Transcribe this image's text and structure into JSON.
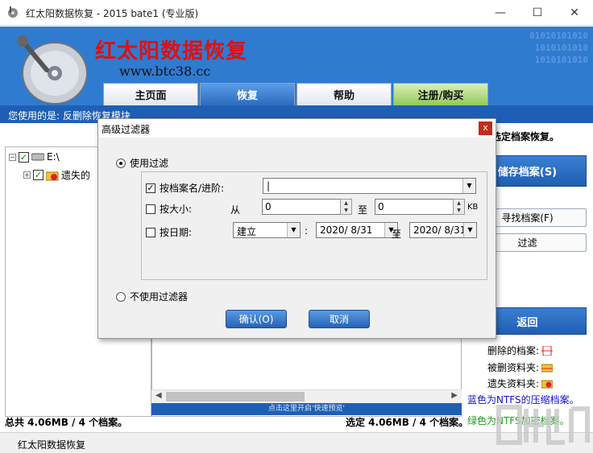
{
  "window": {
    "title": "红太阳数据恢复 - 2015 bate1 (专业版)",
    "minimize": "—",
    "maximize": "☐",
    "close": "✕"
  },
  "banner": {
    "brand": "红太阳数据恢复",
    "url": "www.btc38.cc",
    "binary_lines": [
      "01010101010",
      "1010101010",
      "1010101010"
    ]
  },
  "nav_tabs": [
    {
      "label": "主页面"
    },
    {
      "label": "恢复"
    },
    {
      "label": "帮助"
    },
    {
      "label": "注册/购买"
    }
  ],
  "status_top": "您使用的是: 反删除恢复模块",
  "main": {
    "right_hint": "选定档案恢复。",
    "tree": {
      "drive_label": "E:\\",
      "child_label": "遗失的\u0000"
    },
    "buttons": {
      "save": "储存档案(S)",
      "find": "寻找档案(F)",
      "filter": "过滤",
      "back": "返回"
    },
    "legend": {
      "deleted": "删除的档案:",
      "deleted_folder": "被删资料夹:",
      "lost_folder": "遗失资料夹:",
      "blue_note": "蓝色为NTFS的压缩档案。",
      "green_note": "绿色为NTFS加密档案。"
    },
    "preview_bar": "点击这里开启'快速预览'",
    "total_stats": "总共 4.06MB / 4 个档案。",
    "selected_stats": "选定 4.06MB / 4 个档案。"
  },
  "statusbar": "红太阳数据恢复",
  "dialog": {
    "title": "高级过滤器",
    "close": "x",
    "use_filter": "使用过滤",
    "name_path": "按档案名/进阶:",
    "name_value": "|",
    "by_size": "按大小:",
    "from": "从",
    "size_from": "0",
    "to": "至",
    "size_to": "0",
    "kb": "KB",
    "by_date": "按日期:",
    "date_type": "建立",
    "colon": ":",
    "date_from": "2020/ 8/31",
    "date_to": "2020/ 8/31",
    "no_filter": "不使用过滤器",
    "ok": "确认(O)",
    "cancel": "取消"
  },
  "colors": {
    "banner": "#2f7bd0",
    "status_blue": "#1e5fb5",
    "brand_red": "#e01010",
    "blue_note": "#1010d0",
    "green_note": "#1a9a1a"
  }
}
